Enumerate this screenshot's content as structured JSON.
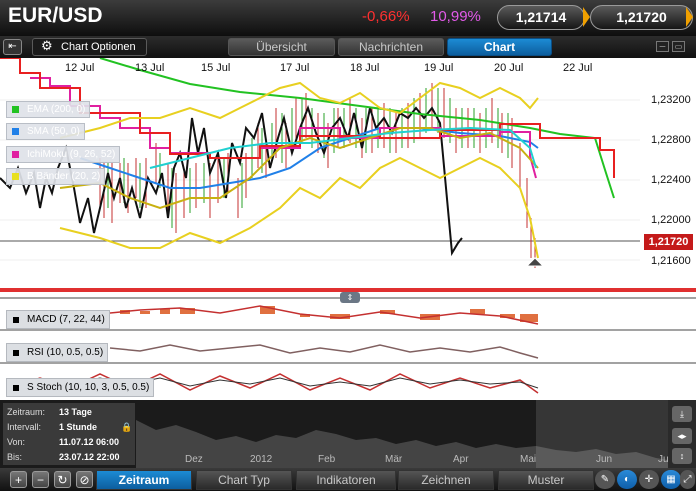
{
  "header": {
    "symbol": "EUR/USD",
    "change_pct": "-0,66%",
    "volatility_pct": "10,99%",
    "bid": "1,21714",
    "ask": "1,21720",
    "colors": {
      "change": "#ff3030",
      "volatility": "#e25ae8",
      "accent": "#f0a000"
    }
  },
  "nav": {
    "back_icon": "⇤",
    "chart_options": "Chart Optionen",
    "tabs": [
      "Übersicht",
      "Nachrichten",
      "Chart"
    ],
    "active_tab": "Chart"
  },
  "chart": {
    "y_labels": [
      "1,23200",
      "1,22800",
      "1,22400",
      "1,22000",
      "1,21600"
    ],
    "x_labels": [
      "12 Jul",
      "13 Jul",
      "15 Jul",
      "17 Jul",
      "18 Jul",
      "19 Jul",
      "20 Jul",
      "22 Jul"
    ],
    "last_price": "1,21720",
    "indicators": [
      {
        "label": "EMA (200, 0)",
        "color": "#22c222"
      },
      {
        "label": "SMA (50, 0)",
        "color": "#2080e8"
      },
      {
        "label": "IchiMoku (9, 26, 52)",
        "color": "#e020a0"
      },
      {
        "label": "B Bänder (20, 2)",
        "color": "#e8e020"
      }
    ],
    "sub_panels": [
      "MACD (7, 22, 44)",
      "RSI (10, 0.5, 0.5)",
      "S Stoch (10, 10, 3, 0.5, 0.5)"
    ]
  },
  "navigator": {
    "zeitraum_label": "Zeitraum:",
    "zeitraum_value": "13 Tage",
    "intervall_label": "Intervall:",
    "intervall_value": "1 Stunde",
    "von_label": "Von:",
    "von_value": "11.07.12 06:00",
    "bis_label": "Bis:",
    "bis_value": "23.07.12 22:00",
    "x_labels": [
      "Dez",
      "2012",
      "Feb",
      "Mär",
      "Apr",
      "Mai",
      "Jun",
      "Jul"
    ]
  },
  "toolbar": {
    "tabs": [
      "Zeitraum",
      "Chart Typ",
      "Indikatoren",
      "Zeichnen",
      "Muster"
    ],
    "active_tab": "Zeitraum"
  }
}
